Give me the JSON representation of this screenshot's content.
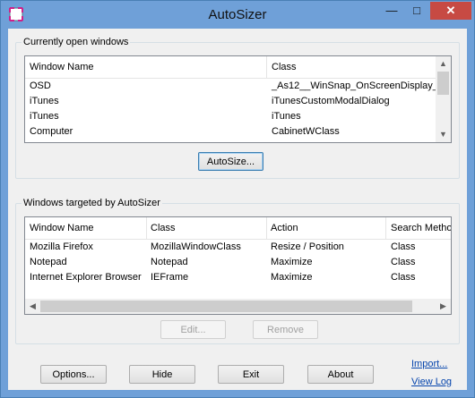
{
  "window": {
    "title": "AutoSizer",
    "minimize_glyph": "—",
    "maximize_glyph": "□",
    "close_glyph": "✕",
    "app_icon": "autosizer-frame-icon"
  },
  "open_windows": {
    "group_title": "Currently open windows",
    "columns": [
      "Window Name",
      "Class"
    ],
    "rows": [
      [
        "OSD",
        "_As12__WinSnap_OnScreenDisplay_"
      ],
      [
        "iTunes",
        "iTunesCustomModalDialog"
      ],
      [
        "iTunes",
        "iTunes"
      ],
      [
        "Computer",
        "CabinetWClass"
      ]
    ],
    "autosize_button": "AutoSize..."
  },
  "targeted_windows": {
    "group_title": "Windows targeted by AutoSizer",
    "columns": [
      "Window Name",
      "Class",
      "Action",
      "Search Metho"
    ],
    "rows": [
      [
        "Mozilla Firefox",
        "MozillaWindowClass",
        "Resize / Position",
        "Class"
      ],
      [
        "Notepad",
        "Notepad",
        "Maximize",
        "Class"
      ],
      [
        "Internet Explorer Browser",
        "IEFrame",
        "Maximize",
        "Class"
      ]
    ],
    "edit_button": "Edit...",
    "remove_button": "Remove"
  },
  "bottom": {
    "options_button": "Options...",
    "hide_button": "Hide",
    "exit_button": "Exit",
    "about_button": "About",
    "import_link": "Import...",
    "viewlog_link": "View Log"
  },
  "colors": {
    "title_bar": "#6fa0d8",
    "close_button": "#c74a43",
    "link": "#0645ad"
  }
}
